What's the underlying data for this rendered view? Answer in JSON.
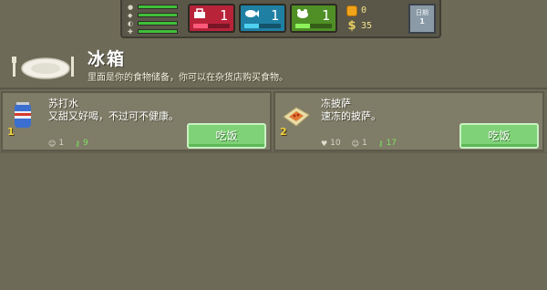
{
  "hud": {
    "stats": [
      {
        "icon": "food-stat-icon",
        "fill": 1.0
      },
      {
        "icon": "mood-stat-icon",
        "fill": 1.0
      },
      {
        "icon": "sleep-stat-icon",
        "fill": 1.0
      },
      {
        "icon": "health-stat-icon",
        "fill": 1.0
      }
    ],
    "resources": {
      "red": {
        "value": "1",
        "icon": "bag-icon",
        "fill": 0.4,
        "color": "#b8233a"
      },
      "blue": {
        "value": "1",
        "icon": "fish-icon",
        "fill": 0.4,
        "color": "#1f80a4"
      },
      "green": {
        "value": "1",
        "icon": "rat-icon",
        "fill": 0.4,
        "color": "#4f8f26"
      }
    },
    "coins": "0",
    "money": "35",
    "date": {
      "label": "日期",
      "day": "1"
    }
  },
  "header": {
    "title": "冰箱",
    "subtitle": "里面是你的食物储备，你可以在杂货店购买食物。"
  },
  "items": [
    {
      "name": "苏打水",
      "desc": "又甜又好喝，不过可不健康。",
      "qty": "1",
      "icon": "soda-can-icon",
      "stats": [
        {
          "icon": "mood-icon",
          "value": "1",
          "color": "default"
        },
        {
          "icon": "key-icon",
          "value": "9",
          "color": "green"
        }
      ],
      "button": "吃饭"
    },
    {
      "name": "冻披萨",
      "desc": "速冻的披萨。",
      "qty": "2",
      "icon": "pizza-box-icon",
      "stats": [
        {
          "icon": "heart-icon",
          "value": "10",
          "color": "default"
        },
        {
          "icon": "mood-icon",
          "value": "1",
          "color": "default"
        },
        {
          "icon": "key-icon",
          "value": "17",
          "color": "green"
        }
      ],
      "button": "吃饭"
    }
  ]
}
